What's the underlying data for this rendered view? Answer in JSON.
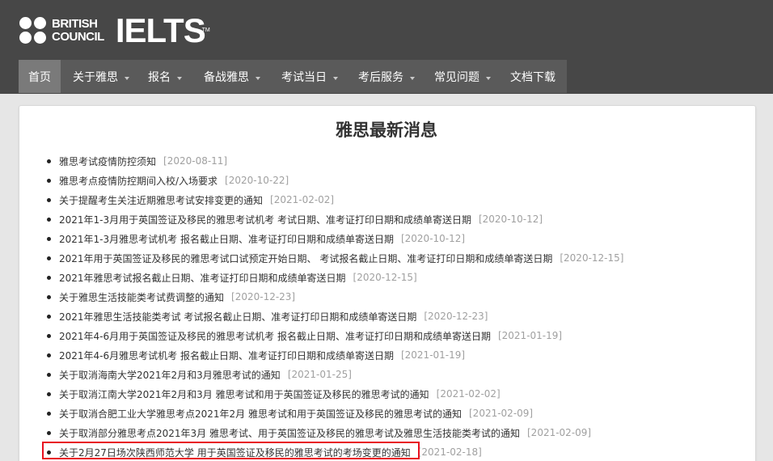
{
  "brand": {
    "council_line1": "BRITISH",
    "council_line2": "COUNCIL",
    "ielts": "IELTS",
    "tm": "TM"
  },
  "nav": [
    {
      "label": "首页",
      "active": true,
      "dropdown": false
    },
    {
      "label": "关于雅思",
      "active": false,
      "dropdown": true
    },
    {
      "label": "报名",
      "active": false,
      "dropdown": true
    },
    {
      "label": "备战雅思",
      "active": false,
      "dropdown": true
    },
    {
      "label": "考试当日",
      "active": false,
      "dropdown": true
    },
    {
      "label": "考后服务",
      "active": false,
      "dropdown": true
    },
    {
      "label": "常见问题",
      "active": false,
      "dropdown": true
    },
    {
      "label": "文档下载",
      "active": false,
      "dropdown": false
    }
  ],
  "page_title": "雅思最新消息",
  "news": [
    {
      "title": "雅思考试疫情防控须知",
      "date": "[2020-08-11]"
    },
    {
      "title": "雅思考点疫情防控期间入校/入场要求",
      "date": "[2020-10-22]"
    },
    {
      "title": "关于提醒考生关注近期雅思考试安排变更的通知",
      "date": "[2021-02-02]"
    },
    {
      "title": "2021年1-3月用于英国签证及移民的雅思考试机考 考试日期、准考证打印日期和成绩单寄送日期",
      "date": "[2020-10-12]"
    },
    {
      "title": "2021年1-3月雅思考试机考 报名截止日期、准考证打印日期和成绩单寄送日期",
      "date": "[2020-10-12]"
    },
    {
      "title": "2021年用于英国签证及移民的雅思考试口试预定开始日期、 考试报名截止日期、准考证打印日期和成绩单寄送日期",
      "date": "[2020-12-15]"
    },
    {
      "title": "2021年雅思考试报名截止日期、准考证打印日期和成绩单寄送日期",
      "date": "[2020-12-15]"
    },
    {
      "title": "关于雅思生活技能类考试费调整的通知",
      "date": "[2020-12-23]"
    },
    {
      "title": "2021年雅思生活技能类考试 考试报名截止日期、准考证打印日期和成绩单寄送日期",
      "date": "[2020-12-23]"
    },
    {
      "title": "2021年4-6月用于英国签证及移民的雅思考试机考 报名截止日期、准考证打印日期和成绩单寄送日期",
      "date": "[2021-01-19]"
    },
    {
      "title": "2021年4-6月雅思考试机考 报名截止日期、准考证打印日期和成绩单寄送日期",
      "date": "[2021-01-19]"
    },
    {
      "title": "关于取消海南大学2021年2月和3月雅思考试的通知",
      "date": "[2021-01-25]"
    },
    {
      "title": "关于取消江南大学2021年2月和3月 雅思考试和用于英国签证及移民的雅思考试的通知",
      "date": "[2021-02-02]"
    },
    {
      "title": "关于取消合肥工业大学雅思考点2021年2月 雅思考试和用于英国签证及移民的雅思考试的通知",
      "date": "[2021-02-09]"
    },
    {
      "title": "关于取消部分雅思考点2021年3月 雅思考试、用于英国签证及移民的雅思考试及雅思生活技能类考试的通知",
      "date": "[2021-02-09]"
    },
    {
      "title": "关于2月27日场次陕西师范大学 用于英国签证及移民的雅思考试的考场变更的通知",
      "date": "[2021-02-18]"
    }
  ],
  "colors": {
    "header_bg": "#474747",
    "nav_bg": "#5a5a5a",
    "nav_active_bg": "#7a7a7a",
    "date_gray": "#a0a0a0",
    "highlight_red": "#e8101f"
  }
}
